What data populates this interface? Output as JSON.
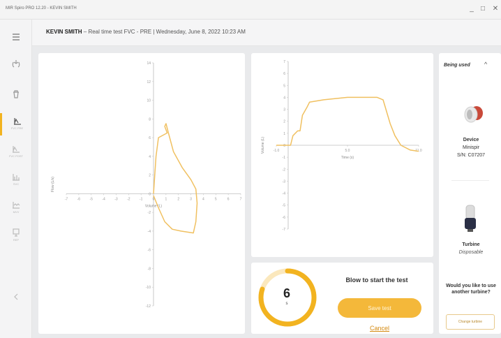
{
  "window": {
    "title": "MIR Spiro PRO 12.20 - KEVIN SMITH",
    "minimize": "_",
    "maximize": "□",
    "close": "✕"
  },
  "sidebar": {
    "items": [
      {
        "icon": "menu-icon",
        "label": ""
      },
      {
        "icon": "lungs-icon",
        "label": ""
      },
      {
        "icon": "trash-icon",
        "label": ""
      },
      {
        "icon": "fvc-test-icon",
        "label": "FVC PRE"
      },
      {
        "icon": "fvc-post-icon",
        "label": "FVC POST"
      },
      {
        "icon": "svc-icon",
        "label": "SVC"
      },
      {
        "icon": "mvv-icon",
        "label": "MVV"
      },
      {
        "icon": "report-icon",
        "label": "REP"
      },
      {
        "icon": "back-icon",
        "label": ""
      }
    ]
  },
  "header": {
    "patient": "KEVIN SMITH",
    "details": " – Real time test FVC - PRE  |  Wednesday, June 8, 2022 10:23 AM"
  },
  "chart_data": [
    {
      "type": "line",
      "description": "Flow / Volume loop",
      "xlabel": "Volume (L)",
      "ylabel": "Flow (L/s)",
      "xlim": [
        -7,
        7
      ],
      "ylim": [
        -12,
        14
      ],
      "xticks": [
        -7,
        -6,
        -5,
        -4,
        -3,
        -2,
        -1,
        0,
        1,
        2,
        3,
        4,
        5,
        6,
        7
      ],
      "yticks": [
        14,
        12,
        10,
        8,
        6,
        4,
        2,
        0,
        -2,
        -4,
        -6,
        -8,
        -10,
        -12
      ],
      "points": [
        [
          0,
          -0.2
        ],
        [
          0.4,
          -1.5
        ],
        [
          0.9,
          -3
        ],
        [
          1.5,
          -3.8
        ],
        [
          2.2,
          -4
        ],
        [
          3.2,
          -4.2
        ],
        [
          3.4,
          -3
        ],
        [
          3.5,
          -1
        ],
        [
          3.4,
          0.5
        ],
        [
          3,
          1.5
        ],
        [
          2.3,
          2.8
        ],
        [
          1.6,
          4.5
        ],
        [
          1.2,
          6.5
        ],
        [
          1,
          7.5
        ],
        [
          0.9,
          7.2
        ],
        [
          1.1,
          6.5
        ],
        [
          0.4,
          6
        ],
        [
          0.2,
          4
        ],
        [
          0.1,
          2
        ],
        [
          0,
          0
        ]
      ]
    },
    {
      "type": "line",
      "description": "Volume / Time",
      "xlabel": "Time (s)",
      "ylabel": "Volume (L)",
      "xlim": [
        -1,
        11
      ],
      "ylim": [
        -7,
        7
      ],
      "xticks": [
        -1,
        5,
        11
      ],
      "xticklabels": [
        "-1.0",
        "5.0",
        "11.0"
      ],
      "yticks": [
        7,
        6,
        5,
        4,
        3,
        2,
        1,
        0,
        -1,
        -2,
        -3,
        -4,
        -5,
        -6,
        -7
      ],
      "points": [
        [
          -1,
          0
        ],
        [
          0.2,
          0
        ],
        [
          0.4,
          0.8
        ],
        [
          0.8,
          1.2
        ],
        [
          1,
          1.2
        ],
        [
          1.2,
          2.5
        ],
        [
          1.6,
          3.2
        ],
        [
          1.8,
          3.6
        ],
        [
          3,
          3.8
        ],
        [
          4,
          3.9
        ],
        [
          5,
          4
        ],
        [
          6,
          4
        ],
        [
          7.5,
          4
        ],
        [
          8,
          3.8
        ],
        [
          8.3,
          2.8
        ],
        [
          8.6,
          1.8
        ],
        [
          9,
          0.8
        ],
        [
          9.5,
          0
        ],
        [
          10.3,
          -0.4
        ],
        [
          11,
          -0.5
        ]
      ]
    }
  ],
  "test": {
    "countdown": "6",
    "countdown_unit": "s",
    "gauge_progress": 0.8,
    "instruction": "Blow to start the test",
    "save_label": "Save test",
    "cancel_label": "Cancel"
  },
  "devices": {
    "title": "Being used",
    "device_name": "Device",
    "device_model": "Minispir",
    "device_sn": "S/N: C07207",
    "turbine_name": "Turbine",
    "turbine_type": "Disposable",
    "question": "Would you like to use another turbine?",
    "change_label": "Change turbine"
  },
  "colors": {
    "accent": "#f2b320",
    "curve": "#f0c060",
    "button": "#f4b83a"
  }
}
